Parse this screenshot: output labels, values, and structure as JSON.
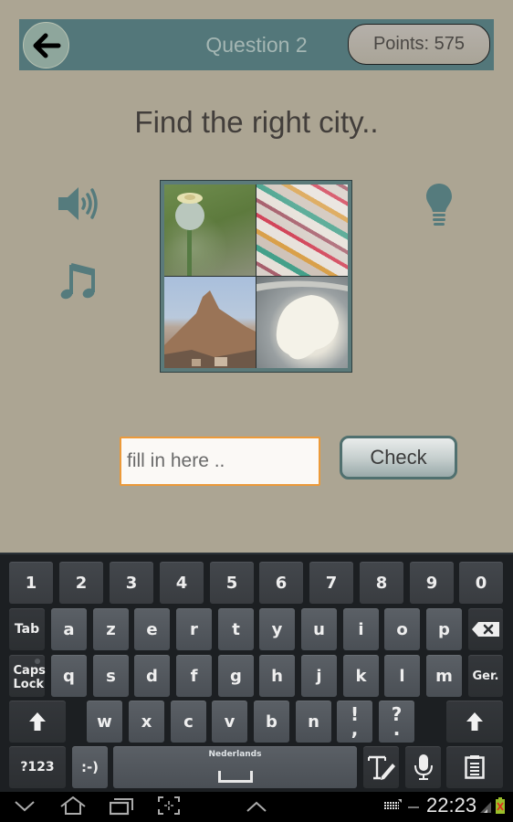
{
  "header": {
    "back_icon": "arrow-left-icon",
    "title": "Question 2",
    "points_label": "Points: 575"
  },
  "question": {
    "prompt": "Find the right city..",
    "speaker_icon": "speaker-icon",
    "music_icon": "music-note-icon",
    "hint_icon": "lightbulb-icon",
    "images": [
      {
        "subject": "poppy seed head"
      },
      {
        "subject": "turkish delight"
      },
      {
        "subject": "rocky mountain with town"
      },
      {
        "subject": "clotted cream"
      }
    ]
  },
  "answer": {
    "placeholder": "fill in here ..",
    "value": "",
    "check_label": "Check"
  },
  "keyboard": {
    "number_row": [
      "1",
      "2",
      "3",
      "4",
      "5",
      "6",
      "7",
      "8",
      "9",
      "0"
    ],
    "row1": {
      "tab": "Tab",
      "keys": [
        "a",
        "z",
        "e",
        "r",
        "t",
        "y",
        "u",
        "i",
        "o",
        "p"
      ],
      "backspace_icon": "backspace-icon"
    },
    "row2": {
      "caps": "Caps Lock",
      "keys": [
        "q",
        "s",
        "d",
        "f",
        "g",
        "h",
        "j",
        "k",
        "l",
        "m"
      ],
      "ger": "Ger."
    },
    "row3": {
      "shift_icon": "shift-icon",
      "keys": [
        "w",
        "x",
        "c",
        "v",
        "b",
        "n"
      ],
      "punct1_top": "!",
      "punct1_bottom": ",",
      "punct2_top": "?",
      "punct2_bottom": "."
    },
    "row4": {
      "symbols": "?123",
      "emoji": ":-)",
      "space_language": "Nederlands",
      "handwriting_icon": "text-pen-icon",
      "mic_icon": "microphone-icon",
      "clipboard_icon": "clipboard-icon"
    }
  },
  "system_bar": {
    "clock": "22:23",
    "back_icon": "chevron-down-icon",
    "home_icon": "home-icon",
    "recents_icon": "recent-apps-icon",
    "screenshot_icon": "screenshot-icon",
    "up_icon": "chevron-up-icon",
    "keyboard_icon": "keyboard-icon",
    "signal_icon": "signal-icon",
    "battery_icon": "battery-icon"
  }
}
